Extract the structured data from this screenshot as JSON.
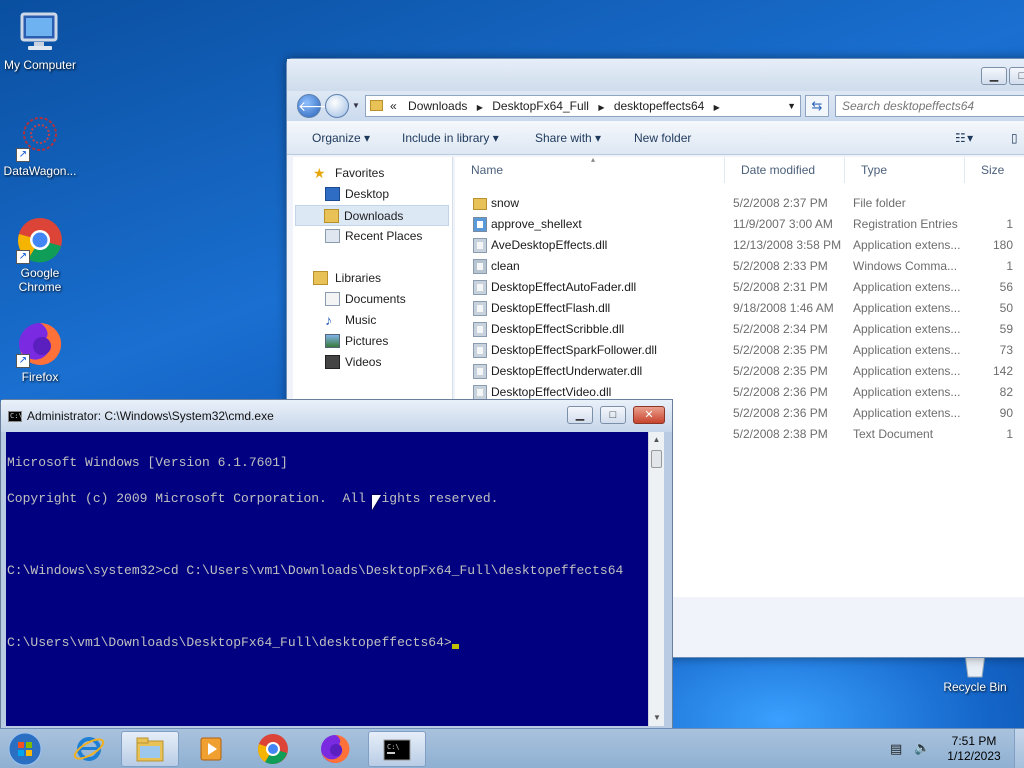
{
  "desktop": {
    "icons": [
      {
        "label": "My Computer"
      },
      {
        "label": "DataWagon..."
      },
      {
        "label": "Google Chrome"
      },
      {
        "label": "Firefox"
      },
      {
        "label": "Recycle Bin"
      }
    ]
  },
  "explorer": {
    "breadcrumb": [
      "Downloads",
      "DesktopFx64_Full",
      "desktopeffects64"
    ],
    "breadcrumb_prefix": "«",
    "search_placeholder": "Search desktopeffects64",
    "toolbar": {
      "organize": "Organize",
      "include": "Include in library",
      "share": "Share with",
      "new_folder": "New folder"
    },
    "nav": {
      "favorites": "Favorites",
      "desktop": "Desktop",
      "downloads": "Downloads",
      "recent": "Recent Places",
      "libraries": "Libraries",
      "documents": "Documents",
      "music": "Music",
      "pictures": "Pictures",
      "videos": "Videos"
    },
    "columns": {
      "name": "Name",
      "date": "Date modified",
      "type": "Type",
      "size": "Size"
    },
    "files": [
      {
        "name": "snow",
        "date": "5/2/2008 2:37 PM",
        "type": "File folder",
        "size": "",
        "icon": "folder-icon"
      },
      {
        "name": "approve_shellext",
        "date": "11/9/2007 3:00 AM",
        "type": "Registration Entries",
        "size": "1",
        "icon": "registry-file-icon"
      },
      {
        "name": "AveDesktopEffects.dll",
        "date": "12/13/2008 3:58 PM",
        "type": "Application extens...",
        "size": "180",
        "icon": "dll-file-icon"
      },
      {
        "name": "clean",
        "date": "5/2/2008 2:33 PM",
        "type": "Windows Comma...",
        "size": "1",
        "icon": "batch-file-icon"
      },
      {
        "name": "DesktopEffectAutoFader.dll",
        "date": "5/2/2008 2:31 PM",
        "type": "Application extens...",
        "size": "56",
        "icon": "dll-file-icon"
      },
      {
        "name": "DesktopEffectFlash.dll",
        "date": "9/18/2008 1:46 AM",
        "type": "Application extens...",
        "size": "50",
        "icon": "dll-file-icon"
      },
      {
        "name": "DesktopEffectScribble.dll",
        "date": "5/2/2008 2:34 PM",
        "type": "Application extens...",
        "size": "59",
        "icon": "dll-file-icon"
      },
      {
        "name": "DesktopEffectSparkFollower.dll",
        "date": "5/2/2008 2:35 PM",
        "type": "Application extens...",
        "size": "73",
        "icon": "dll-file-icon"
      },
      {
        "name": "DesktopEffectUnderwater.dll",
        "date": "5/2/2008 2:35 PM",
        "type": "Application extens...",
        "size": "142",
        "icon": "dll-file-icon"
      },
      {
        "name": "DesktopEffectVideo.dll",
        "date": "5/2/2008 2:36 PM",
        "type": "Application extens...",
        "size": "82",
        "icon": "dll-file-icon"
      },
      {
        "name": "",
        "date": "5/2/2008 2:36 PM",
        "type": "Application extens...",
        "size": "90",
        "icon": ""
      },
      {
        "name": "",
        "date": "5/2/2008 2:38 PM",
        "type": "Text Document",
        "size": "1",
        "icon": ""
      }
    ]
  },
  "cmd": {
    "title": "Administrator: C:\\Windows\\System32\\cmd.exe",
    "lines": [
      "Microsoft Windows [Version 6.1.7601]",
      "Copyright (c) 2009 Microsoft Corporation.  All rights reserved.",
      "",
      "C:\\Windows\\system32>cd C:\\Users\\vm1\\Downloads\\DesktopFx64_Full\\desktopeffects64",
      "",
      "C:\\Users\\vm1\\Downloads\\DesktopFx64_Full\\desktopeffects64>"
    ],
    "colors": {
      "background": "#000080",
      "text": "#c0c0c0"
    }
  },
  "taskbar": {
    "time": "7:51 PM",
    "date": "1/12/2023",
    "items": [
      "start-orb",
      "internet-explorer",
      "windows-explorer",
      "media-player",
      "google-chrome",
      "firefox",
      "command-prompt"
    ]
  }
}
